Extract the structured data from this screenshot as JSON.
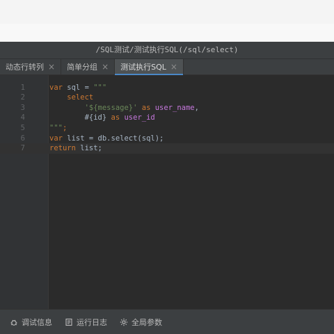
{
  "window": {
    "path_title": "/SQL测试/测试执行SQL(/sql/select)"
  },
  "tabs": [
    {
      "label": "动态行转列",
      "active": false
    },
    {
      "label": "简单分组",
      "active": false
    },
    {
      "label": "测试执行SQL",
      "active": true
    }
  ],
  "editor": {
    "lines": [
      {
        "n": "1",
        "parts": [
          {
            "t": "var",
            "c": "kw"
          },
          {
            "t": " sql = ",
            "c": ""
          },
          {
            "t": "\"\"\"",
            "c": "str"
          }
        ]
      },
      {
        "n": "2",
        "parts": [
          {
            "t": "    select",
            "c": "sqlkw"
          }
        ]
      },
      {
        "n": "3",
        "parts": [
          {
            "t": "        ",
            "c": ""
          },
          {
            "t": "'${message}'",
            "c": "str"
          },
          {
            "t": " as ",
            "c": "sqlkw"
          },
          {
            "t": "user_name",
            "c": "alias"
          },
          {
            "t": ",",
            "c": ""
          }
        ]
      },
      {
        "n": "4",
        "parts": [
          {
            "t": "        #{id}",
            "c": ""
          },
          {
            "t": " as ",
            "c": "sqlkw"
          },
          {
            "t": "user_id",
            "c": "alias"
          }
        ]
      },
      {
        "n": "5",
        "parts": [
          {
            "t": "\"\"\"",
            "c": "str"
          },
          {
            "t": ";",
            "c": "kw"
          }
        ]
      },
      {
        "n": "6",
        "parts": [
          {
            "t": "var",
            "c": "kw"
          },
          {
            "t": " list = db.select(sql);",
            "c": ""
          }
        ]
      },
      {
        "n": "7",
        "parts": [
          {
            "t": "return",
            "c": "kw"
          },
          {
            "t": " list;",
            "c": ""
          }
        ]
      }
    ],
    "current_line": "7"
  },
  "bottom": {
    "debug_label": "调试信息",
    "log_label": "运行日志",
    "params_label": "全局参数",
    "icons": [
      "bug-icon",
      "log-icon",
      "gear-icon"
    ]
  },
  "colors": {
    "accent": "#4a88c7",
    "editor_bg": "#2b2b2b",
    "panel_bg": "#3c3f41"
  }
}
